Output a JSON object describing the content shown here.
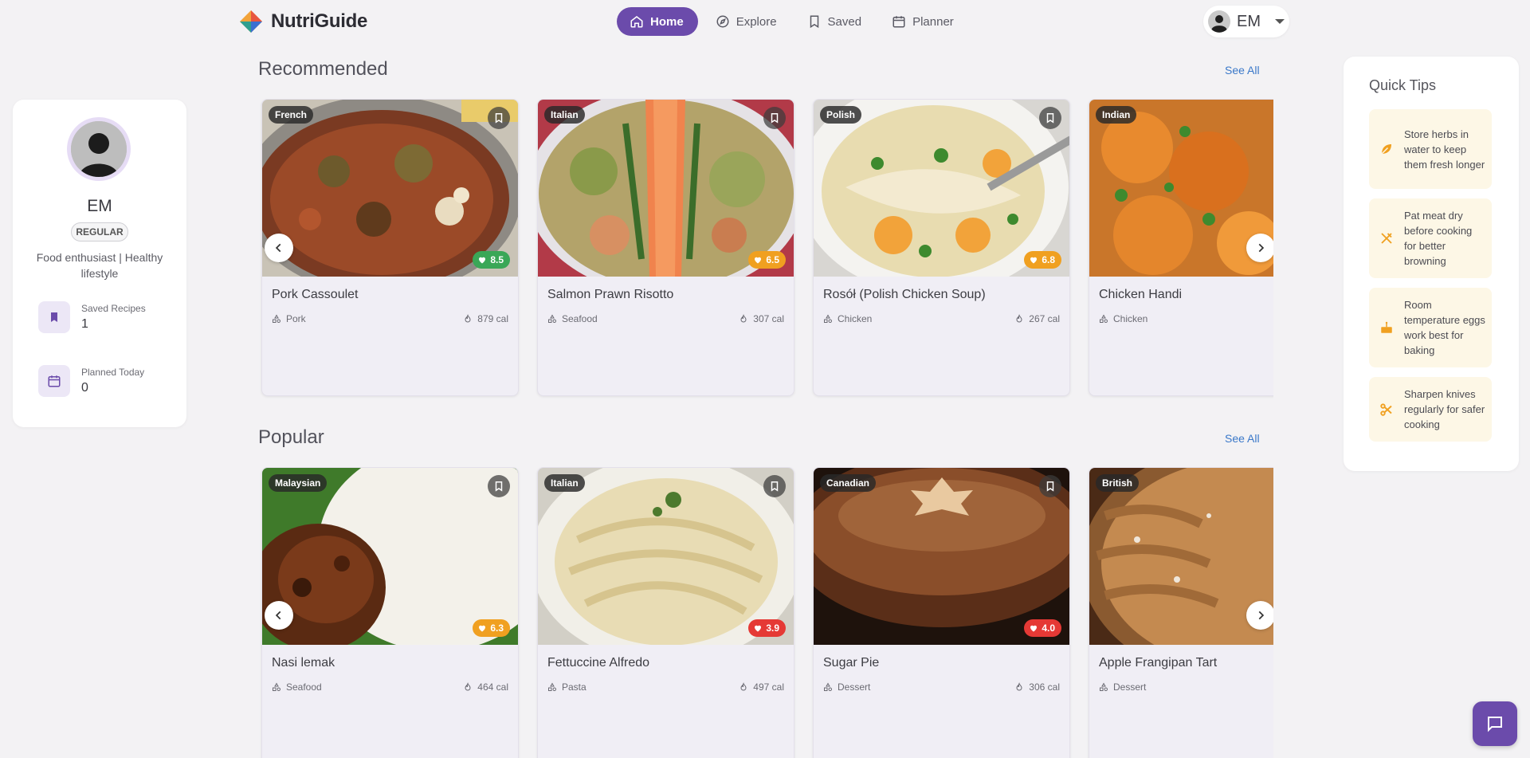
{
  "brand": {
    "name": "NutriGuide"
  },
  "nav": [
    {
      "label": "Home",
      "icon": "home-icon",
      "active": true
    },
    {
      "label": "Explore",
      "icon": "compass-icon",
      "active": false
    },
    {
      "label": "Saved",
      "icon": "bookmark-icon",
      "active": false
    },
    {
      "label": "Planner",
      "icon": "calendar-icon",
      "active": false
    }
  ],
  "user": {
    "initials": "EM"
  },
  "profile": {
    "name": "EM",
    "badge": "REGULAR",
    "bio": "Food enthusiast | Healthy lifestyle",
    "stats": [
      {
        "label": "Saved Recipes",
        "value": "1",
        "icon": "bookmark-icon"
      },
      {
        "label": "Planned Today",
        "value": "0",
        "icon": "calendar-icon"
      }
    ]
  },
  "sections": [
    {
      "title": "Recommended",
      "see_all": "See All",
      "cards": [
        {
          "cuisine": "French",
          "title": "Pork Cassoulet",
          "category": "Pork",
          "calories": "879 cal",
          "score": "8.5",
          "score_color": "#3aa757"
        },
        {
          "cuisine": "Italian",
          "title": "Salmon Prawn Risotto",
          "category": "Seafood",
          "calories": "307 cal",
          "score": "6.5",
          "score_color": "#f0a020"
        },
        {
          "cuisine": "Polish",
          "title": "Rosół (Polish Chicken Soup)",
          "category": "Chicken",
          "calories": "267 cal",
          "score": "6.8",
          "score_color": "#f0a020"
        },
        {
          "cuisine": "Indian",
          "title": "Chicken Handi",
          "category": "Chicken",
          "calories": "",
          "score": "",
          "score_color": "#f0a020"
        }
      ]
    },
    {
      "title": "Popular",
      "see_all": "See All",
      "cards": [
        {
          "cuisine": "Malaysian",
          "title": "Nasi lemak",
          "category": "Seafood",
          "calories": "464 cal",
          "score": "6.3",
          "score_color": "#f0a020"
        },
        {
          "cuisine": "Italian",
          "title": "Fettuccine Alfredo",
          "category": "Pasta",
          "calories": "497 cal",
          "score": "3.9",
          "score_color": "#e53935"
        },
        {
          "cuisine": "Canadian",
          "title": "Sugar Pie",
          "category": "Dessert",
          "calories": "306 cal",
          "score": "4.0",
          "score_color": "#e53935"
        },
        {
          "cuisine": "British",
          "title": "Apple Frangipan Tart",
          "category": "Dessert",
          "calories": "",
          "score": "",
          "score_color": "#f0a020"
        }
      ]
    }
  ],
  "tips": {
    "title": "Quick Tips",
    "items": [
      {
        "text": "Store herbs in water to keep them fresh longer",
        "icon": "leaf-icon"
      },
      {
        "text": "Pat meat dry before cooking for better browning",
        "icon": "utensils-icon"
      },
      {
        "text": "Room temperature eggs work best for baking",
        "icon": "cake-icon"
      },
      {
        "text": "Sharpen knives regularly for safer cooking",
        "icon": "scissors-icon"
      }
    ]
  },
  "colors": {
    "accent": "#6b4bab",
    "link": "#3a78c9",
    "tip_bg": "#fdf7e6",
    "tip_icon": "#f0a020"
  }
}
